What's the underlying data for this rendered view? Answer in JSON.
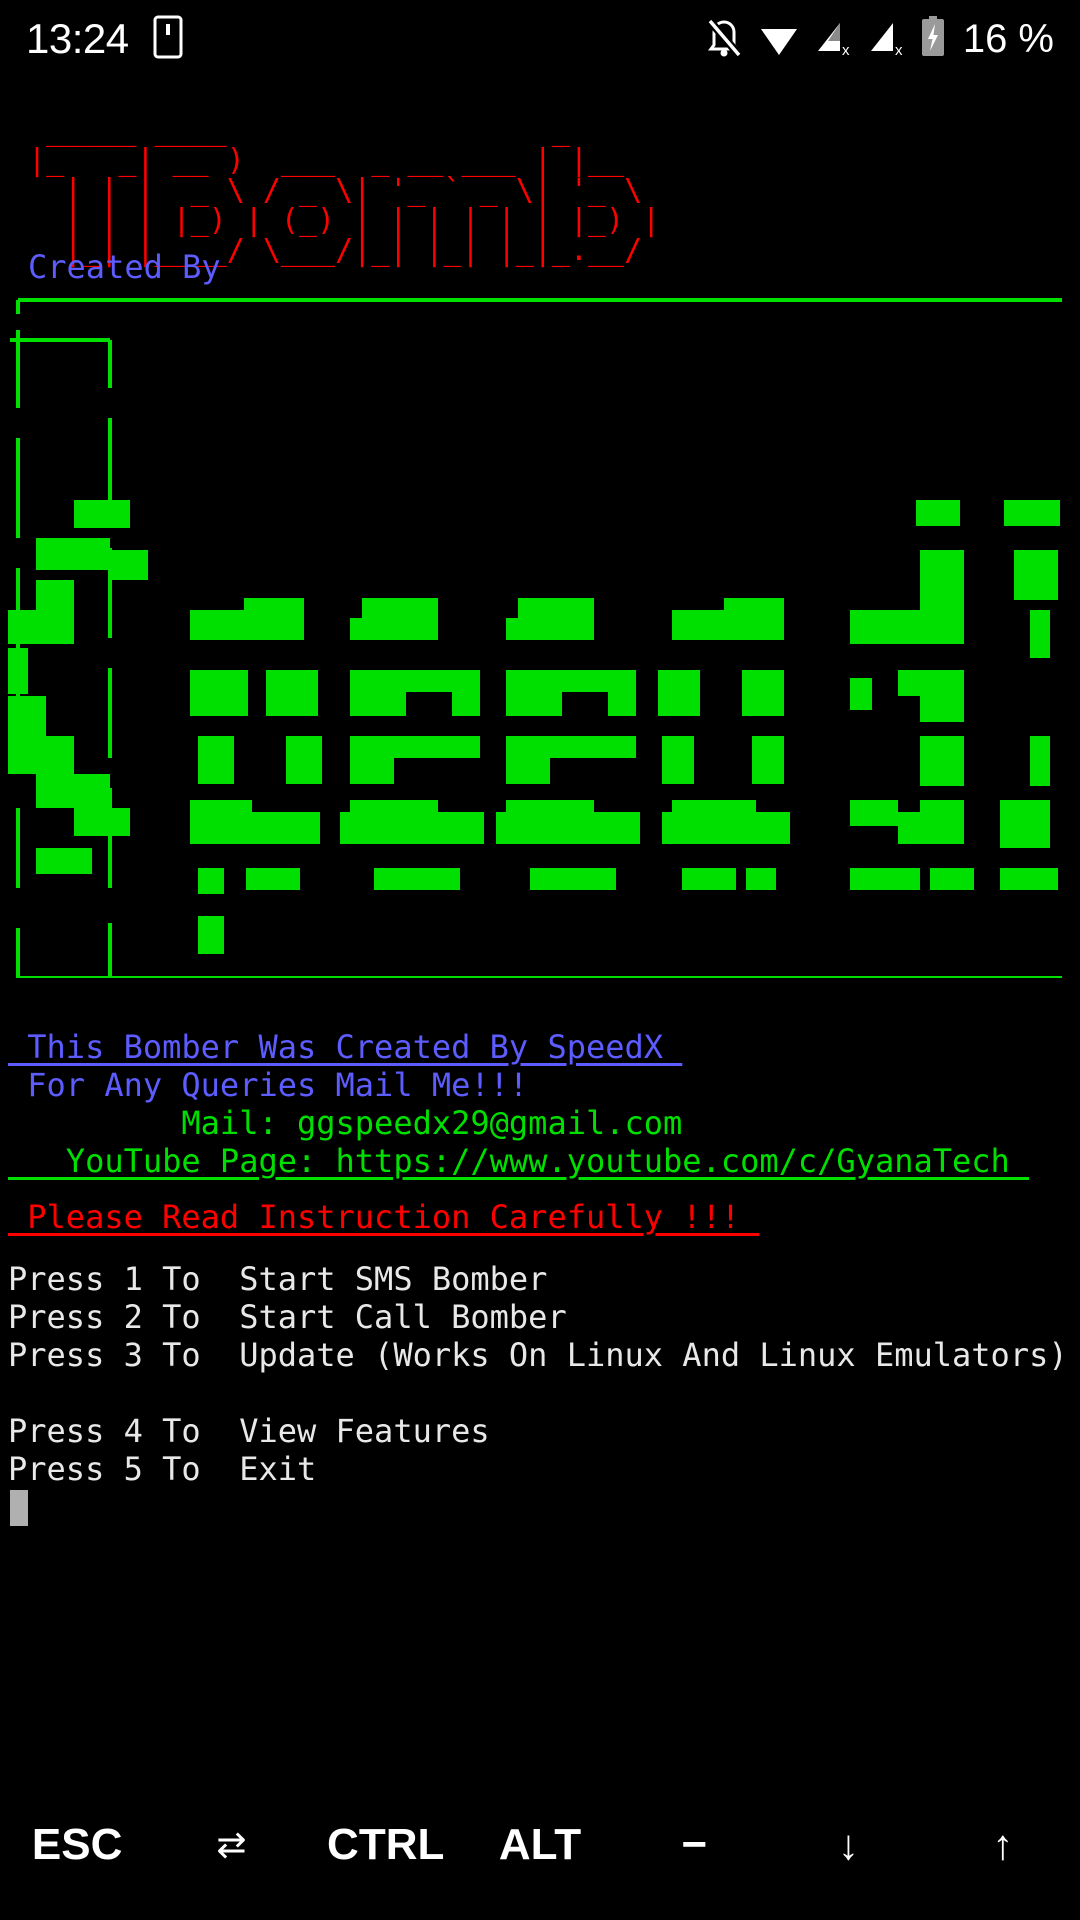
{
  "status_bar": {
    "clock": "13:24",
    "battery_percent": "16 %",
    "icons": [
      "device-icon",
      "notifications-off-icon",
      "wifi-icon",
      "signal-1-no-service-icon",
      "signal-2-no-service-icon",
      "battery-charging-icon"
    ]
  },
  "terminal": {
    "banner_ascii": "  _____ ____                  _     \n |_   _| __ )  ___  _ __ ___ | |__  \n   | | |  _ \\ / _ \\| '_ ` _ \\| '_ \\ \n   | | | |_) | (_) | | | | | | |_) |\n   |_| |____/ \\___/|_| |_| |_|_.__/ ",
    "created_by_label": "Created By",
    "speedx_ascii": "╔══════════════════════════════════════════════════╗\n║                                                  ║\n║   ▄████  ▄▄▄▄▄▄                           ██  ██ ║\n║  ██      ██    ██                          ██ ██  ║\n║  ▀███▄   ██▄▄▄▄██  ▄████  ▄████  ▄████  ▄█  ███   ║\n║     ▀██  ██       ██▄▄██ ██▄▄██ ██   ██  ██ ██    ║\n║  ▄▄▄▄██  ██       ██     ██     ██   ██ ██  ██ ██ ║\n║  ▀████▀  ██        ▀████  ▀████  ▀████  ▀██ ██ ██ ║\n║          ██                                       ║\n║                                                  ║\n╚══════════════════════════════════════════════════╝",
    "credit_line_1": " This Bomber Was Created By SpeedX ",
    "credit_line_2": " For Any Queries Mail Me!!!",
    "mail_line": "         Mail: ggspeedx29@gmail.com",
    "youtube_line": "   YouTube Page: https://www.youtube.com/c/GyanaTech ",
    "warning_line": " Please Read Instruction Carefully !!! ",
    "menu": [
      "Press 1 To  Start SMS Bomber",
      "Press 2 To  Start Call Bomber",
      "Press 3 To  Update (Works On Linux And Linux Emulators)",
      "Press 4 To  View Features",
      "Press 5 To  Exit"
    ],
    "colors": {
      "banner": "#ff0000",
      "created_by": "#5c5cff",
      "speedx_art": "#00e000",
      "credit": "#5c5cff",
      "mail": "#00e000",
      "warning": "#ff0000",
      "menu": "#e8e8e8",
      "background": "#000000"
    }
  },
  "key_row": {
    "keys": [
      {
        "label": "ESC",
        "name": "esc-key"
      },
      {
        "label": "⇄",
        "name": "tab-key"
      },
      {
        "label": "CTRL",
        "name": "ctrl-key"
      },
      {
        "label": "ALT",
        "name": "alt-key"
      },
      {
        "label": "−",
        "name": "minus-key"
      },
      {
        "label": "↓",
        "name": "arrow-down-key"
      },
      {
        "label": "↑",
        "name": "arrow-up-key"
      }
    ]
  }
}
